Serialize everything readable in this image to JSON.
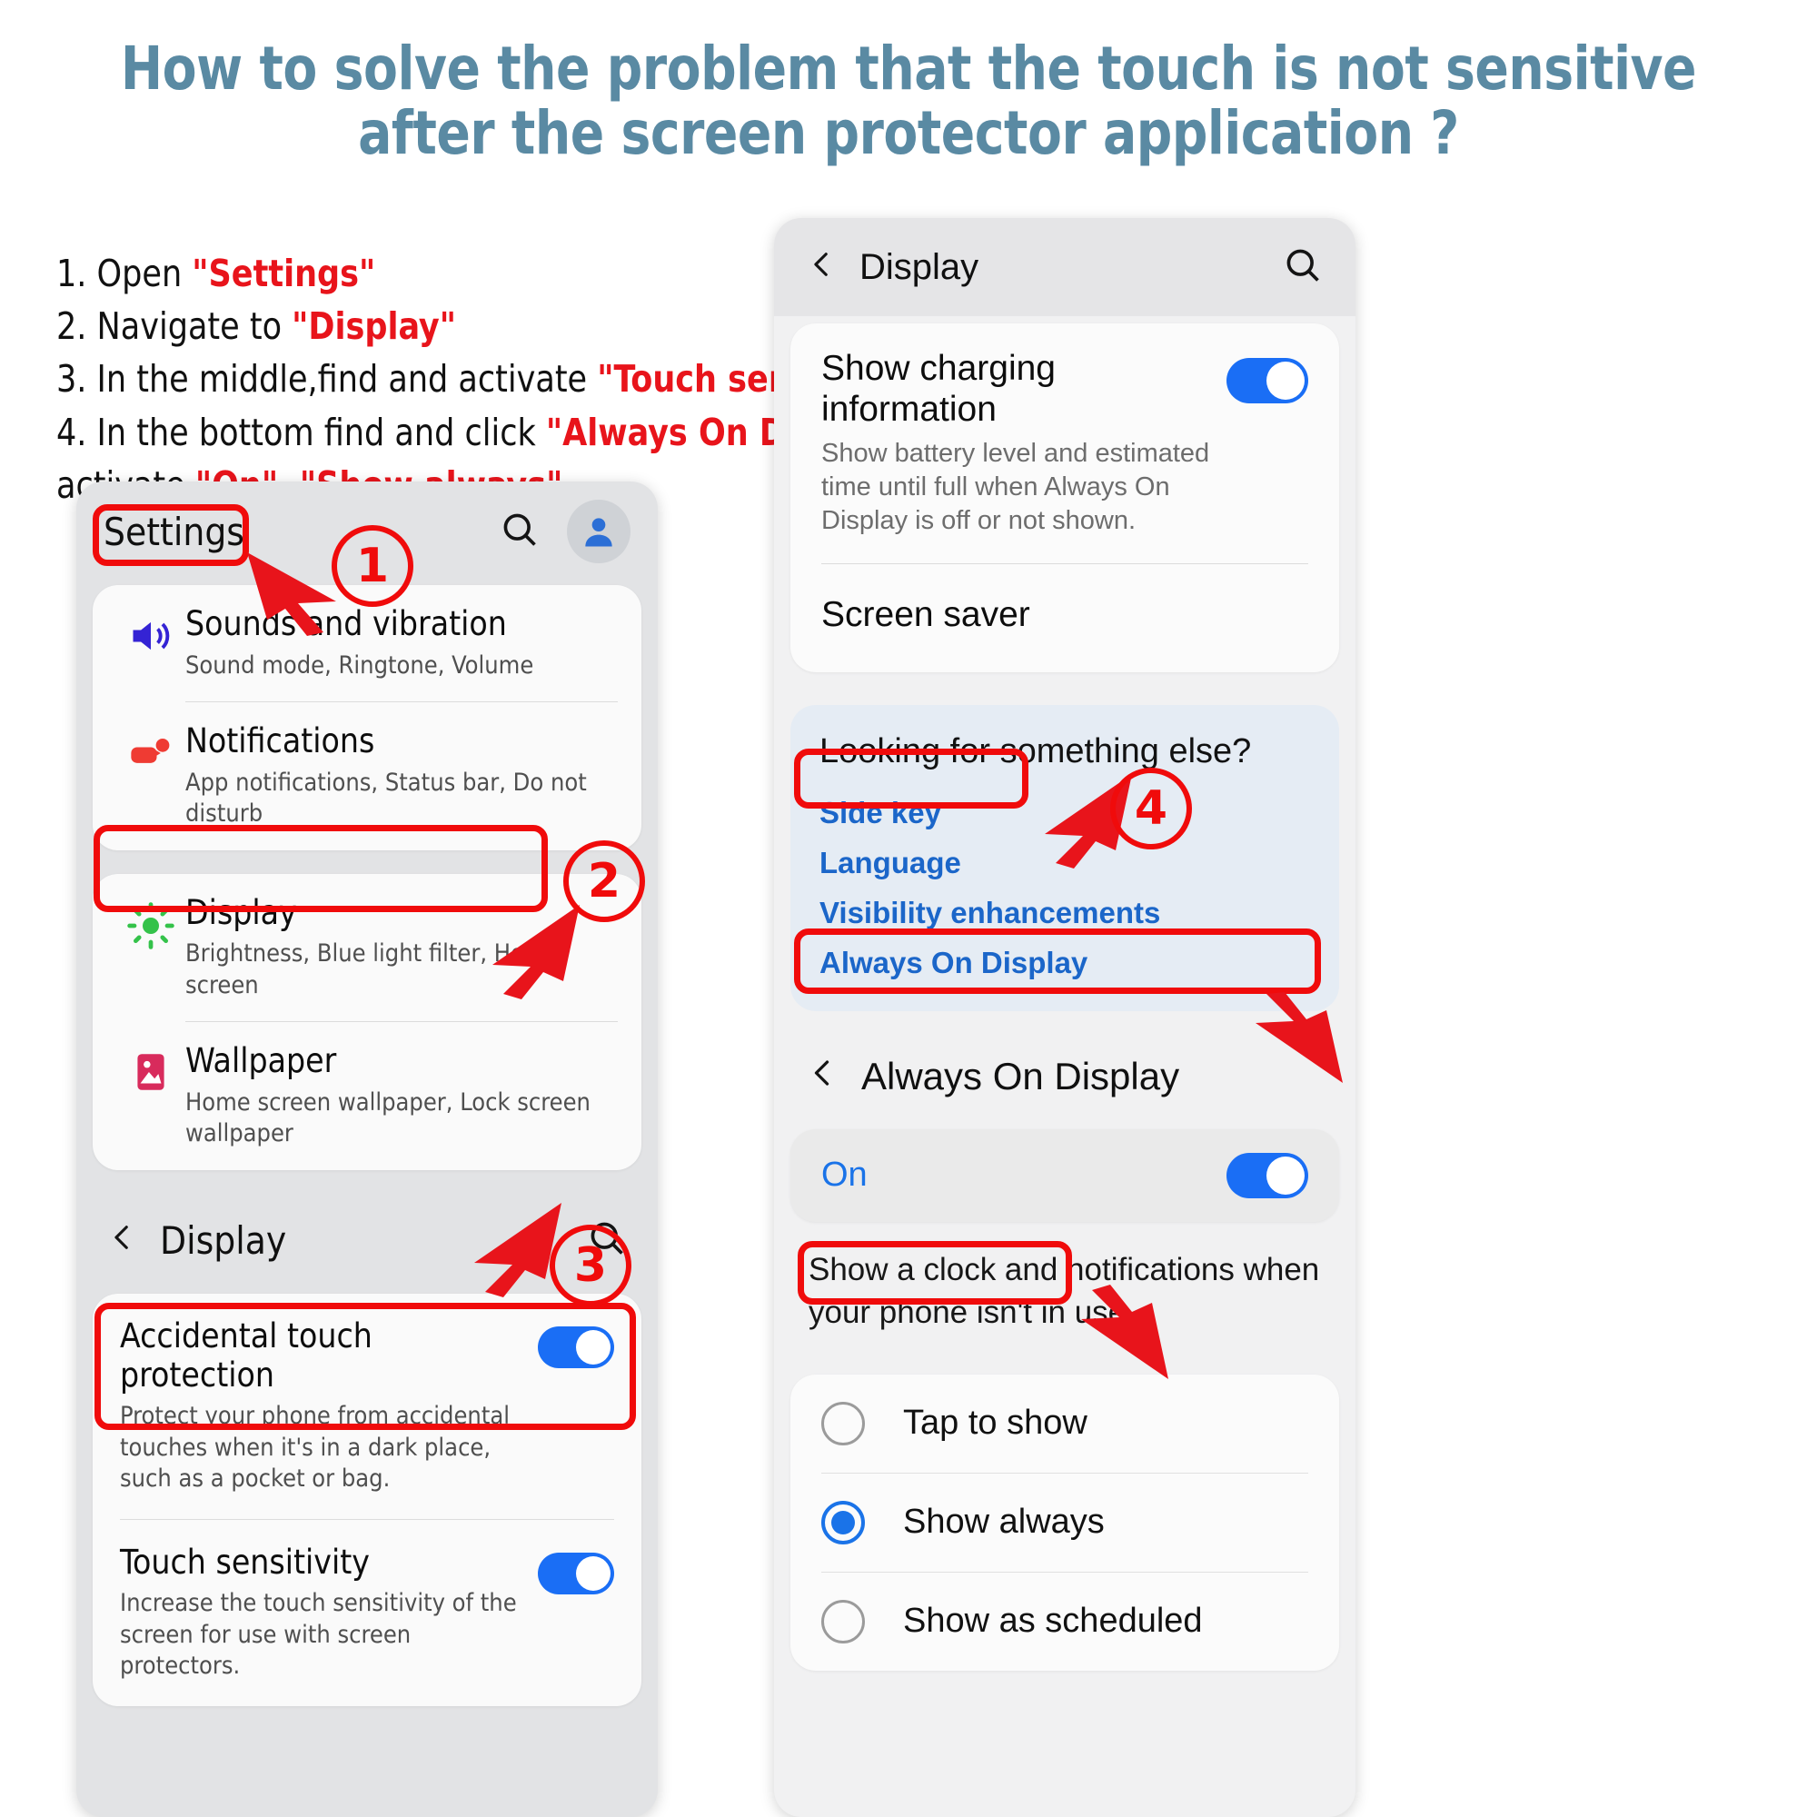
{
  "title": "How to solve the problem that the touch is not sensitive after  the screen protector application ?",
  "title_line1": "How to solve the problem that the touch is not sensitive",
  "title_line2": "after  the screen protector application ?",
  "title_color": "#5a8aa3",
  "highlight_color": "#e8141b",
  "steps": [
    {
      "num": "1.",
      "pre": "Open ",
      "hi": "\"Settings\"",
      "post": ""
    },
    {
      "num": "2.",
      "pre": "Navigate to ",
      "hi": "\"Display\"",
      "post": ""
    },
    {
      "num": "3.",
      "pre": "In the middle,find and activate ",
      "hi": "\"Touch sensitivity\"",
      "post": ""
    },
    {
      "num": "4.",
      "pre": "In the bottom find and click ",
      "hi": "\"Always On Display\"",
      "post": "-"
    }
  ],
  "step4_cont": {
    "pre": "activate ",
    "hi1": "\"On\"",
    "mid": "- ",
    "hi2": "\"Show always\""
  },
  "markers": {
    "one": "①",
    "two": "②",
    "three": "③",
    "four": "④",
    "m1": "1",
    "m2": "2",
    "m3": "3",
    "m4": "4"
  },
  "left_phone": {
    "header": {
      "title": "Settings",
      "search_icon": "search-icon",
      "avatar_icon": "account-avatar-icon"
    },
    "group1": [
      {
        "icon": "speaker-volume-icon",
        "title": "Sounds and vibration",
        "subtitle": "Sound mode, Ringtone, Volume"
      },
      {
        "icon": "notification-bell-icon",
        "title": "Notifications",
        "subtitle": "App notifications, Status bar, Do not disturb"
      }
    ],
    "group2": [
      {
        "icon": "brightness-sun-icon",
        "title": "Display",
        "subtitle": "Brightness, Blue light filter, Home screen"
      },
      {
        "icon": "wallpaper-image-icon",
        "title": "Wallpaper",
        "subtitle": "Home screen wallpaper, Lock screen wallpaper"
      }
    ],
    "display_header": {
      "title": "Display",
      "back_icon": "chevron-left-icon",
      "search_icon": "search-icon"
    },
    "group3": [
      {
        "title": "Accidental touch protection",
        "subtitle": "Protect your phone from accidental touches when it's in a dark place, such as a pocket or bag.",
        "toggle": "on"
      },
      {
        "title": "Touch sensitivity",
        "subtitle": "Increase the touch sensitivity of the screen for use with screen protectors.",
        "toggle": "on"
      }
    ]
  },
  "right_phone": {
    "display_header": {
      "title": "Display",
      "back_icon": "chevron-left-icon",
      "search_icon": "search-icon"
    },
    "charging": {
      "title": "Show charging information",
      "subtitle": "Show battery level and estimated time until full when Always On Display is off or not shown.",
      "toggle": "on"
    },
    "screen_saver": "Screen saver",
    "suggestions": {
      "question": "Looking for something else?",
      "links": [
        "Side key",
        "Language",
        "Visibility enhancements",
        "Always On Display"
      ]
    },
    "aod_header": {
      "title": "Always On Display",
      "back_icon": "chevron-left-icon"
    },
    "aod_toggle": {
      "label": "On",
      "toggle": "on"
    },
    "aod_description": "Show a clock and notifications when your phone isn't in use.",
    "aod_options": [
      {
        "label": "Tap to show",
        "selected": false
      },
      {
        "label": "Show always",
        "selected": true
      },
      {
        "label": "Show as scheduled",
        "selected": false
      }
    ]
  }
}
